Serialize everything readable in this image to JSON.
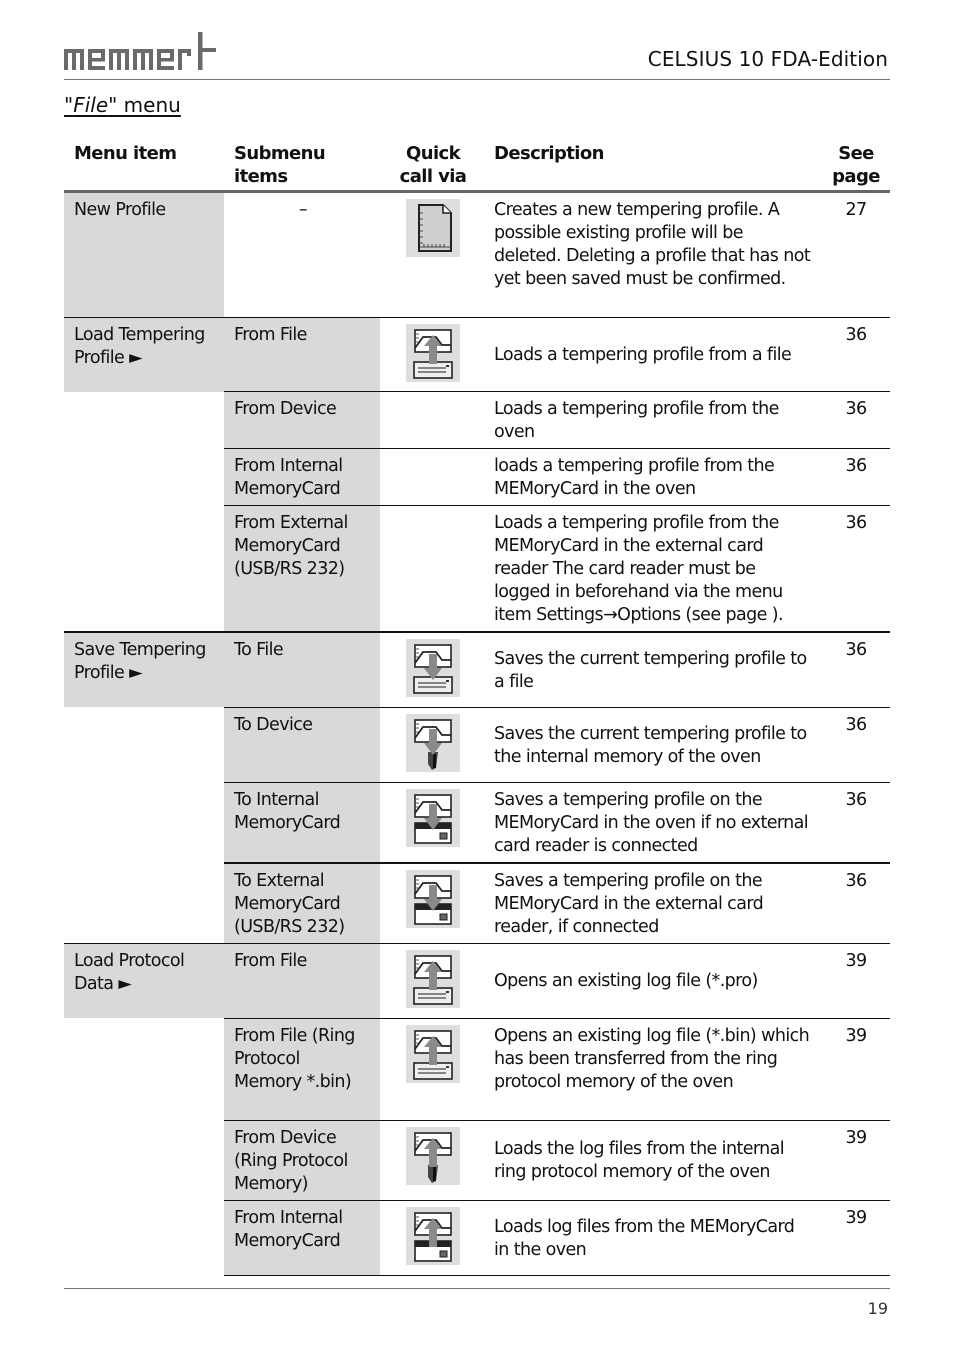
{
  "header": {
    "brand": "memmert",
    "doc_title": "CELSIUS 10 FDA-Edition",
    "section_title_prefix": "\"",
    "section_title_italic": "File",
    "section_title_suffix": "\" menu"
  },
  "table": {
    "columns": [
      "Menu item",
      "Submenu items",
      "Quick call via",
      "Description",
      "See page"
    ],
    "column_lines": {
      "submenu": [
        "Submenu",
        "items"
      ],
      "quick": [
        "Quick",
        "call via"
      ],
      "page": [
        "See",
        "page"
      ]
    },
    "rows": [
      {
        "menu_item": "New Profile",
        "submenu": "–",
        "icon": "new-document-icon",
        "description": "Creates a new tempering profile. A possible existing profile will be deleted. Deleting a profile that has not yet been saved must be confirmed.",
        "page": "27"
      },
      {
        "menu_item": "Load Tempering Profile ►",
        "submenu": "From File",
        "icon": "load-from-file-icon",
        "description": "Loads a tempering profile from a file",
        "page": "36"
      },
      {
        "menu_item": "",
        "submenu": "From Device",
        "icon": "",
        "description": "Loads a tempering profile from the oven",
        "page": "36"
      },
      {
        "menu_item": "",
        "submenu": "From Internal MemoryCard",
        "icon": "",
        "description": "loads a tempering profile from the MEMoryCard in the oven",
        "page": "36"
      },
      {
        "menu_item": "",
        "submenu": "From External MemoryCard (USB/RS 232)",
        "icon": "",
        "description": "Loads a tempering profile from the MEMoryCard in the external card reader The card reader must be logged in beforehand via the menu item Settings→Options (see page ).",
        "page": "36"
      },
      {
        "menu_item": "Save Tempering Profile ►",
        "submenu": "To File",
        "icon": "save-to-file-icon",
        "description": "Saves the current tempering profile to a file",
        "page": "36"
      },
      {
        "menu_item": "",
        "submenu": "To Device",
        "icon": "save-to-device-icon",
        "description": "Saves the current tempering profile to the internal memory of the oven",
        "page": "36"
      },
      {
        "menu_item": "",
        "submenu": "To Internal MemoryCard",
        "icon": "save-to-memorycard-icon",
        "description": "Saves a tempering profile on the MEMoryCard in the oven if no external card reader is connected",
        "page": "36"
      },
      {
        "menu_item": "",
        "submenu": "To External MemoryCard (USB/RS 232)",
        "icon": "save-to-external-memorycard-icon",
        "description": "Saves a tempering profile on the MEMoryCard in the external card reader, if connected",
        "page": "36"
      },
      {
        "menu_item": "Load Protocol Data ►",
        "submenu": "From File",
        "icon": "load-protocol-from-file-icon",
        "description": "Opens an existing log file (*.pro)",
        "page": "39"
      },
      {
        "menu_item": "",
        "submenu": "From File (Ring Protocol Memory *.bin)",
        "icon": "load-protocol-bin-file-icon",
        "description": "Opens an existing log file (*.bin) which has been transferred from the ring protocol memory of the oven",
        "page": "39"
      },
      {
        "menu_item": "",
        "submenu": "From Device (Ring Protocol Memory)",
        "icon": "load-protocol-from-device-icon",
        "description": "Loads the log files from the internal ring protocol memory of the oven",
        "page": "39"
      },
      {
        "menu_item": "",
        "submenu": "From Internal MemoryCard",
        "icon": "load-protocol-from-memorycard-icon",
        "description": "Loads log files from the MEMoryCard in the oven",
        "page": "39"
      }
    ]
  },
  "footer": {
    "page_number": "19"
  },
  "colors": {
    "cell_grey": "#d9d9d9",
    "icon_bg": "#dedede",
    "arrow": "#888888",
    "rule": "#777777"
  }
}
